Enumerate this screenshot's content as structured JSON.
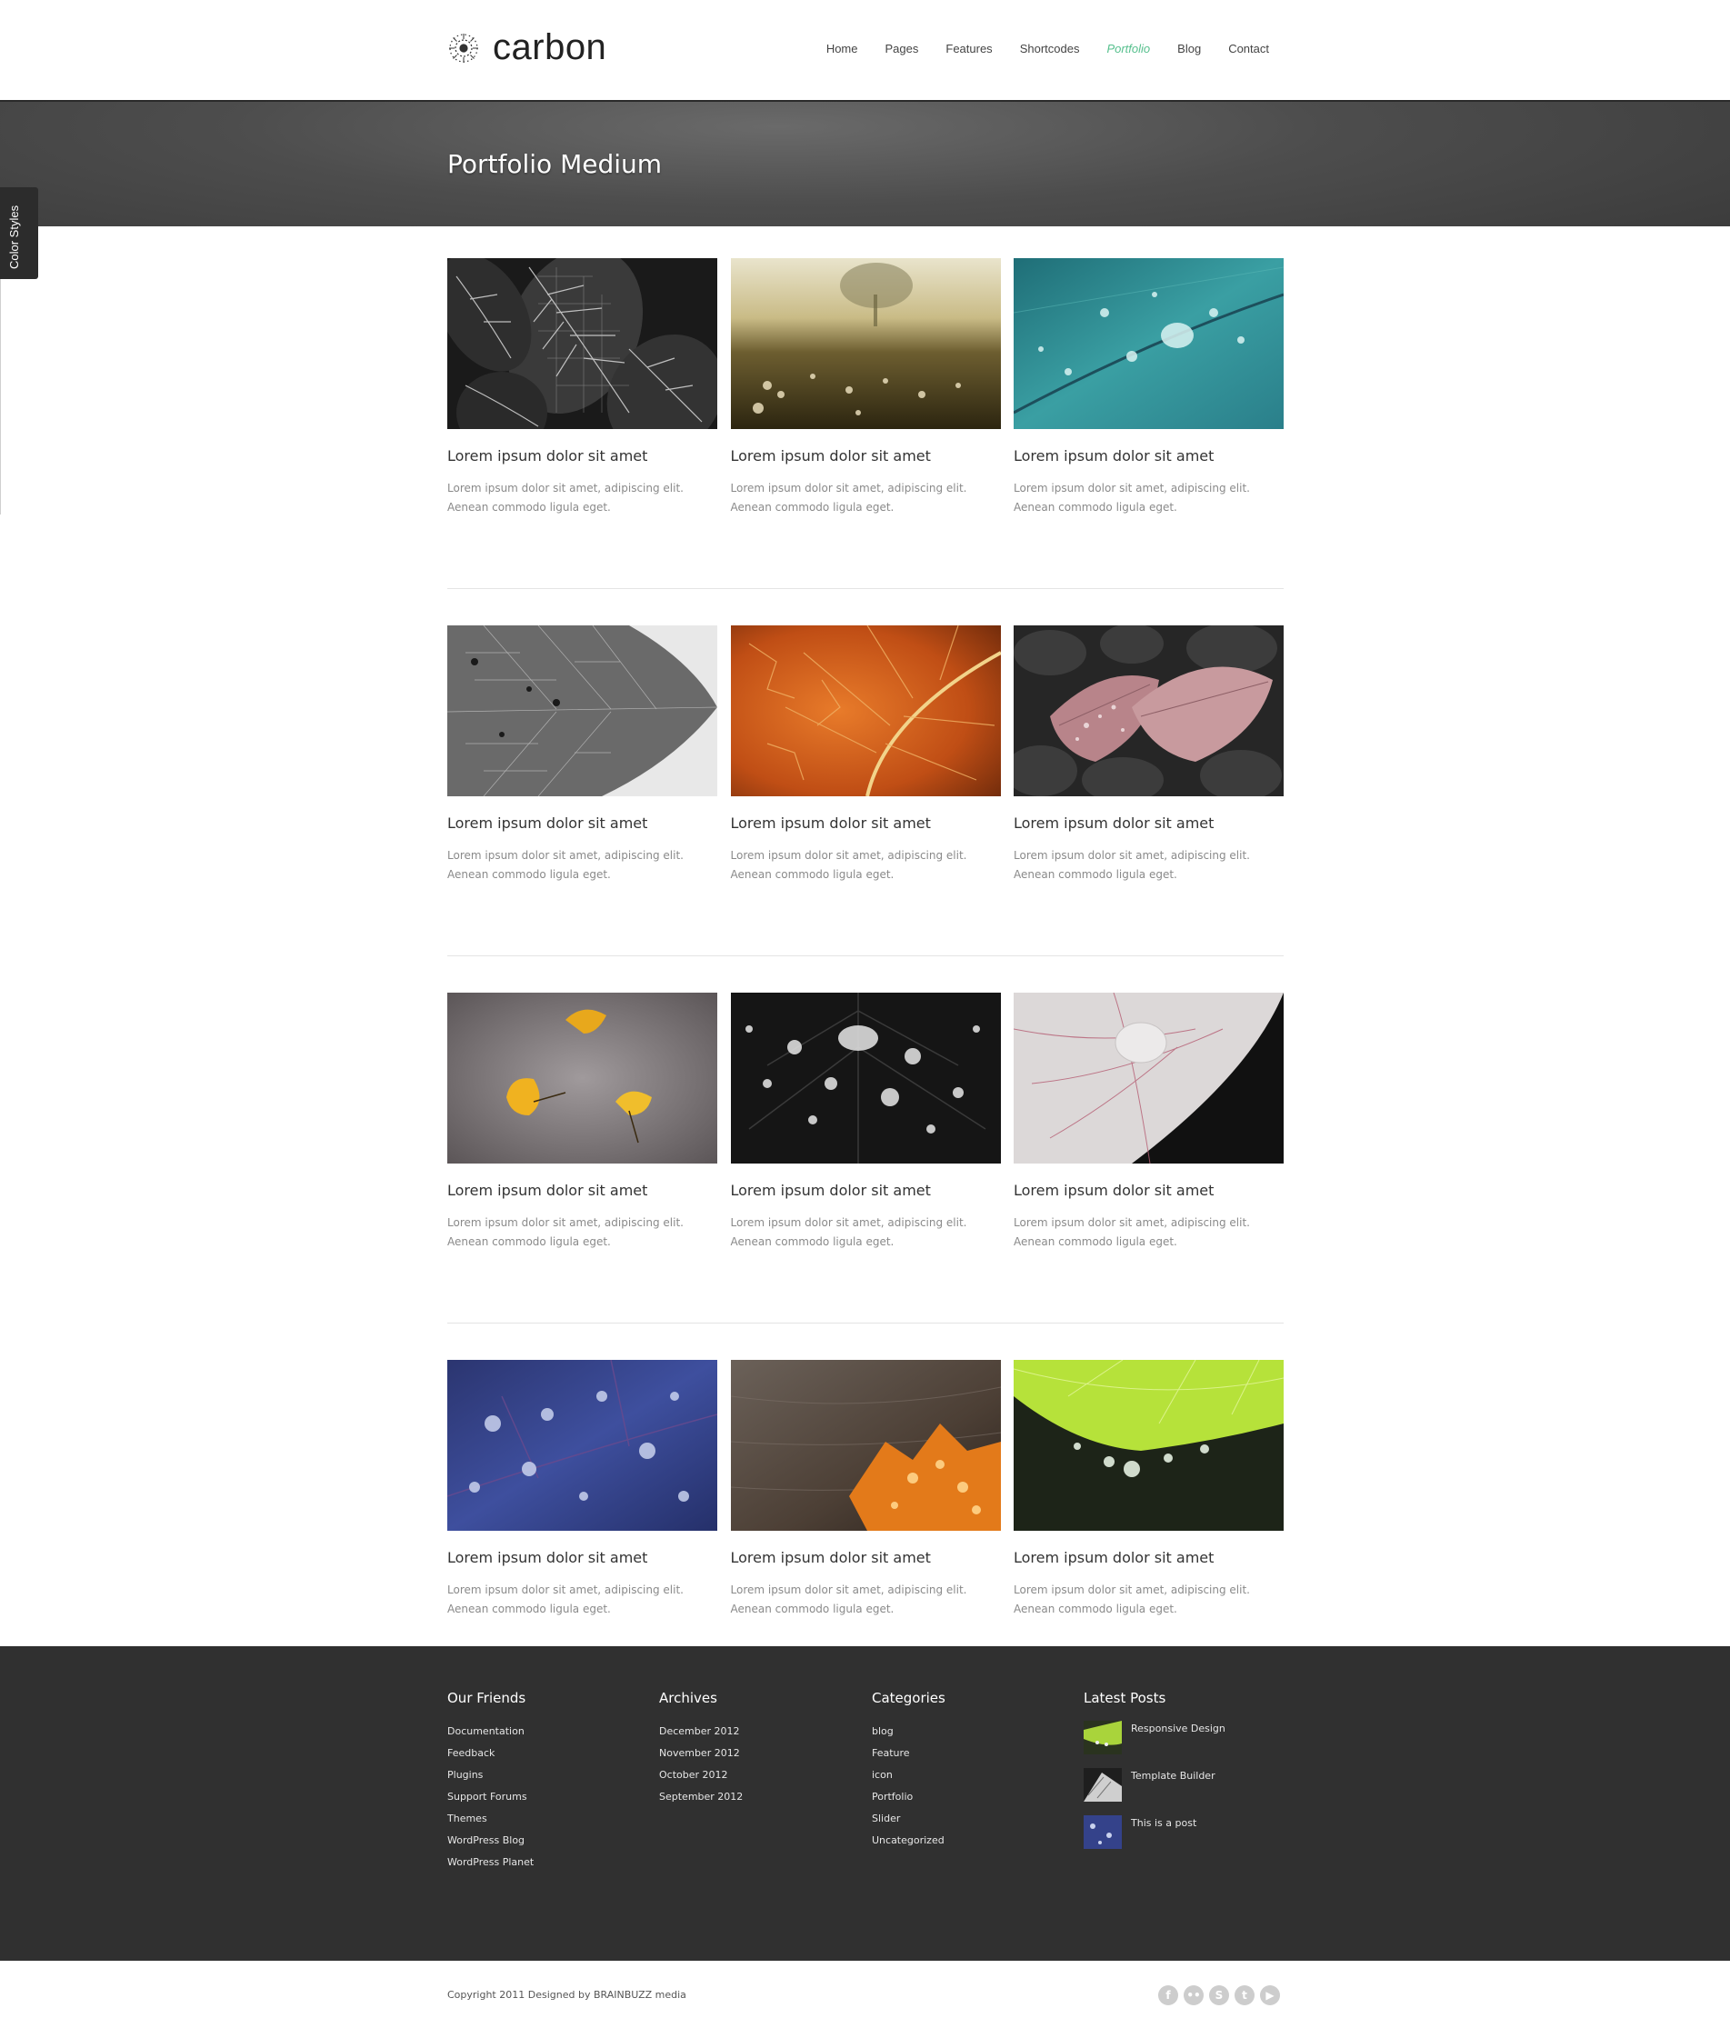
{
  "brand": {
    "name": "carbon"
  },
  "nav": {
    "items": [
      {
        "label": "Home"
      },
      {
        "label": "Pages"
      },
      {
        "label": "Features"
      },
      {
        "label": "Shortcodes"
      },
      {
        "label": "Portfolio",
        "active": true
      },
      {
        "label": "Blog"
      },
      {
        "label": "Contact"
      }
    ]
  },
  "colors": {
    "accent": "#57c08e",
    "footer_bg": "#303030",
    "band_bg": "#4d4d4d"
  },
  "color_tab": {
    "label": "Color Styles"
  },
  "page": {
    "title": "Portfolio Medium"
  },
  "portfolio": {
    "items": [
      {
        "title": "Lorem ipsum dolor sit amet",
        "desc": "Lorem ipsum dolor sit amet, adipiscing elit. Aenean commodo ligula eget.",
        "image": "black-white-leaves"
      },
      {
        "title": "Lorem ipsum dolor sit amet",
        "desc": "Lorem ipsum dolor sit amet, adipiscing elit. Aenean commodo ligula eget.",
        "image": "field-at-sunset"
      },
      {
        "title": "Lorem ipsum dolor sit amet",
        "desc": "Lorem ipsum dolor sit amet, adipiscing elit. Aenean commodo ligula eget.",
        "image": "teal-leaf-droplets"
      },
      {
        "title": "Lorem ipsum dolor sit amet",
        "desc": "Lorem ipsum dolor sit amet, adipiscing elit. Aenean commodo ligula eget.",
        "image": "grey-leaf-veins"
      },
      {
        "title": "Lorem ipsum dolor sit amet",
        "desc": "Lorem ipsum dolor sit amet, adipiscing elit. Aenean commodo ligula eget.",
        "image": "orange-leaf-veins"
      },
      {
        "title": "Lorem ipsum dolor sit amet",
        "desc": "Lorem ipsum dolor sit amet, adipiscing elit. Aenean commodo ligula eget.",
        "image": "pink-leaf-on-stones"
      },
      {
        "title": "Lorem ipsum dolor sit amet",
        "desc": "Lorem ipsum dolor sit amet, adipiscing elit. Aenean commodo ligula eget.",
        "image": "yellow-ginkgo-leaves"
      },
      {
        "title": "Lorem ipsum dolor sit amet",
        "desc": "Lorem ipsum dolor sit amet, adipiscing elit. Aenean commodo ligula eget.",
        "image": "dark-leaf-droplets"
      },
      {
        "title": "Lorem ipsum dolor sit amet",
        "desc": "Lorem ipsum dolor sit amet, adipiscing elit. Aenean commodo ligula eget.",
        "image": "white-leaf-droplet"
      },
      {
        "title": "Lorem ipsum dolor sit amet",
        "desc": "Lorem ipsum dolor sit amet, adipiscing elit. Aenean commodo ligula eget.",
        "image": "blue-leaf-droplets"
      },
      {
        "title": "Lorem ipsum dolor sit amet",
        "desc": "Lorem ipsum dolor sit amet, adipiscing elit. Aenean commodo ligula eget.",
        "image": "orange-leaf-on-wood"
      },
      {
        "title": "Lorem ipsum dolor sit amet",
        "desc": "Lorem ipsum dolor sit amet, adipiscing elit. Aenean commodo ligula eget.",
        "image": "green-leaf-dew"
      }
    ]
  },
  "footer": {
    "friends": {
      "heading": "Our Friends",
      "links": [
        "Documentation",
        "Feedback",
        "Plugins",
        "Support Forums",
        "Themes",
        "WordPress Blog",
        "WordPress Planet"
      ]
    },
    "archives": {
      "heading": "Archives",
      "links": [
        "December 2012",
        "November 2012",
        "October 2012",
        "September 2012"
      ]
    },
    "categories": {
      "heading": "Categories",
      "links": [
        "blog",
        "Feature",
        "icon",
        "Portfolio",
        "Slider",
        "Uncategorized"
      ]
    },
    "latest": {
      "heading": "Latest Posts",
      "posts": [
        {
          "title": "Responsive Design",
          "image": "green-leaf-thumb"
        },
        {
          "title": "Template Builder",
          "image": "bw-thumb"
        },
        {
          "title": "This is a post",
          "image": "blue-thumb"
        }
      ]
    }
  },
  "bottom": {
    "copyright": "Copyright 2011 Designed by BRAINBUZZ media",
    "social": [
      {
        "icon": "facebook-icon",
        "glyph": "f"
      },
      {
        "icon": "flickr-icon",
        "glyph": "••"
      },
      {
        "icon": "skype-icon",
        "glyph": "S"
      },
      {
        "icon": "twitter-icon",
        "glyph": "t"
      },
      {
        "icon": "youtube-icon",
        "glyph": "▶"
      }
    ]
  }
}
